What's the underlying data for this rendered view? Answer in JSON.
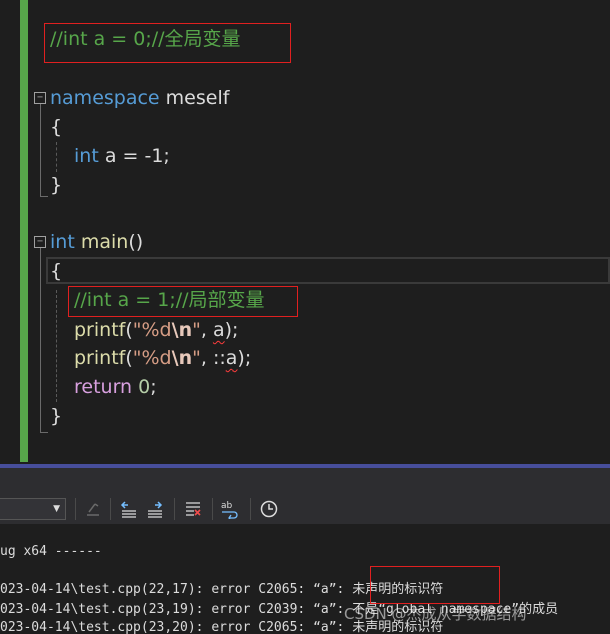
{
  "editor": {
    "global_comment": "//int a = 0;//全局变量",
    "ns_keyword": "namespace",
    "ns_name": "meself",
    "ns_open_brace": "{",
    "ns_int_keyword": "int",
    "ns_var_rest": " a = -1;",
    "ns_close_brace": "}",
    "main_int_keyword": "int",
    "main_name": "main",
    "main_parens": "()",
    "main_open_brace": "{",
    "local_comment": "//int a = 1;//局部变量",
    "printf1": {
      "fn": "printf",
      "paren_open": "(",
      "quote_open": "\"%d",
      "escape": "\\n",
      "quote_close": "\"",
      "comma": ", ",
      "arg": "a",
      "end": ");"
    },
    "printf2": {
      "fn": "printf",
      "paren_open": "(",
      "quote_open": "\"%d",
      "escape": "\\n",
      "quote_close": "\"",
      "comma": ", ",
      "scope": "::",
      "arg": "a",
      "end": ");"
    },
    "return_keyword": "return",
    "return_value": "0",
    "return_end": ";",
    "main_close_brace": "}"
  },
  "output": {
    "build_header": "ug x64 ------",
    "lines": [
      "023-04-14\\test.cpp(22,17): error C2065: “a”: ",
      "023-04-14\\test.cpp(23,19): error C2039: “a”: 不是“global namespace”的成员",
      "023-04-14\\test.cpp(23,20): error C2065: “a”: "
    ],
    "undeclared_msg": "未声明的标识符",
    "undeclared_msg_2": "未声明的标识符"
  },
  "watermark": "CSDN @杰成从学数据结构",
  "colors": {
    "change_bar": "#57a64a",
    "comment": "#57a64a",
    "keyword": "#569cd6",
    "control_keyword": "#d8a0df",
    "function": "#dcdcaa",
    "string": "#d69d85",
    "number": "#b5cea8",
    "highlight_box": "#e02020",
    "panel_divider": "#474e9b"
  }
}
